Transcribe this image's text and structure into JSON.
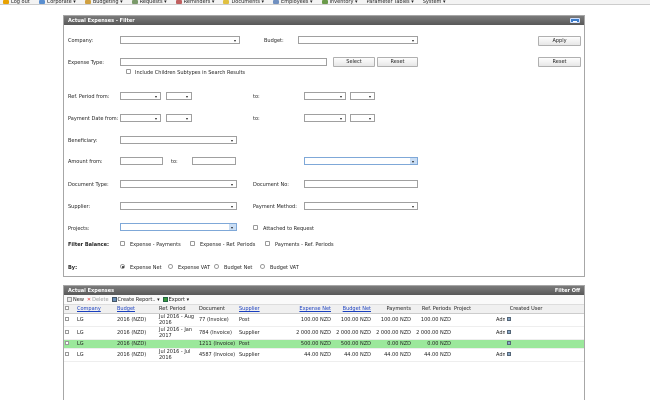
{
  "nav": {
    "items": [
      {
        "label": "Log out",
        "icon": "logout-icon",
        "color": "#e8a100"
      },
      {
        "label": "Corporate ▾",
        "icon": "corporate-icon",
        "color": "#5a8fd0"
      },
      {
        "label": "Budgeting ▾",
        "icon": "budgeting-icon",
        "color": "#d0a040"
      },
      {
        "label": "Requests ▾",
        "icon": "requests-icon",
        "color": "#7a9a6a"
      },
      {
        "label": "Reminders ▾",
        "icon": "reminders-icon",
        "color": "#c06060"
      },
      {
        "label": "Documents ▾",
        "icon": "documents-icon",
        "color": "#e0c040"
      },
      {
        "label": "Employees ▾",
        "icon": "employees-icon",
        "color": "#7090c0"
      },
      {
        "label": "Inventory ▾",
        "icon": "inventory-icon",
        "color": "#6a9a4a"
      },
      {
        "label": "Parameter Tables ▾",
        "icon": "",
        "color": ""
      },
      {
        "label": "System ▾",
        "icon": "",
        "color": ""
      }
    ]
  },
  "filter": {
    "title": "Actual Expenses - Filter",
    "company_label": "Company:",
    "budget_label": "Budget:",
    "expense_type_label": "Expense Type:",
    "include_children_label": "Include Children Subtypes in Search Results",
    "ref_period_from_label": "Ref. Period from:",
    "to_label": "to:",
    "payment_date_from_label": "Payment Date from:",
    "beneficiary_label": "Beneficiary:",
    "amount_from_label": "Amount from:",
    "document_type_label": "Document Type:",
    "document_no_label": "Document No:",
    "supplier_label": "Supplier:",
    "payment_method_label": "Payment Method:",
    "projects_label": "Projects:",
    "attached_label": "Attached to Request",
    "filter_balance_label": "Filter Balance:",
    "balance_options": [
      "Expense - Payments",
      "Expense - Ref. Periods",
      "Payments - Ref. Periods"
    ],
    "by_label": "By:",
    "by_options": [
      "Expense Net",
      "Expense VAT",
      "Budget Net",
      "Budget VAT"
    ],
    "select_button": "Select",
    "reset_inline_button": "Reset",
    "apply_button": "Apply",
    "reset_button": "Reset"
  },
  "results": {
    "title": "Actual Expenses",
    "filter_off_label": "Filter Off",
    "toolbar": {
      "new_label": "New",
      "delete_label": "Delete",
      "create_report_label": "Create Report.. ▾",
      "export_label": "Export ▾"
    },
    "columns": [
      "Company",
      "Budget",
      "Ref. Period",
      "Document",
      "Supplier",
      "Expense Net",
      "Budget Net",
      "Payments",
      "Ref. Periods",
      "Project",
      "Created User"
    ],
    "rows": [
      {
        "company": "LG",
        "budget": "2016 (NZD)",
        "ref_period": "Jul 2016 - Aug 2016",
        "document": "77 (Invoice)",
        "supplier": "Post",
        "expense_net": "100.00 NZD",
        "budget_net": "100.00 NZD",
        "payments": "100.00 NZD",
        "ref_periods": "100.00 NZD",
        "project": "",
        "created_user": "Administrator",
        "highlight": false
      },
      {
        "company": "LG",
        "budget": "2016 (NZD)",
        "ref_period": "Jul 2016 - Jan 2017",
        "document": "784 (Invoice)",
        "supplier": "Supplier",
        "expense_net": "2 000.00 NZD",
        "budget_net": "2 000.00 NZD",
        "payments": "2 000.00 NZD",
        "ref_periods": "2 000.00 NZD",
        "project": "",
        "created_user": "Administrator",
        "highlight": false
      },
      {
        "company": "LG",
        "budget": "2016 (NZD)",
        "ref_period": "",
        "document": "1211 (Invoice)",
        "supplier": "Post",
        "expense_net": "500.00 NZD",
        "budget_net": "500.00 NZD",
        "payments": "0.00 NZD",
        "ref_periods": "0.00 NZD",
        "project": "",
        "created_user": "",
        "highlight": true
      },
      {
        "company": "LG",
        "budget": "2016 (NZD)",
        "ref_period": "Jul 2016 - Jul 2016",
        "document": "4587 (Invoice)",
        "supplier": "Supplier",
        "expense_net": "44.00 NZD",
        "budget_net": "44.00 NZD",
        "payments": "44.00 NZD",
        "ref_periods": "44.00 NZD",
        "project": "",
        "created_user": "Administrator",
        "highlight": false
      }
    ]
  }
}
